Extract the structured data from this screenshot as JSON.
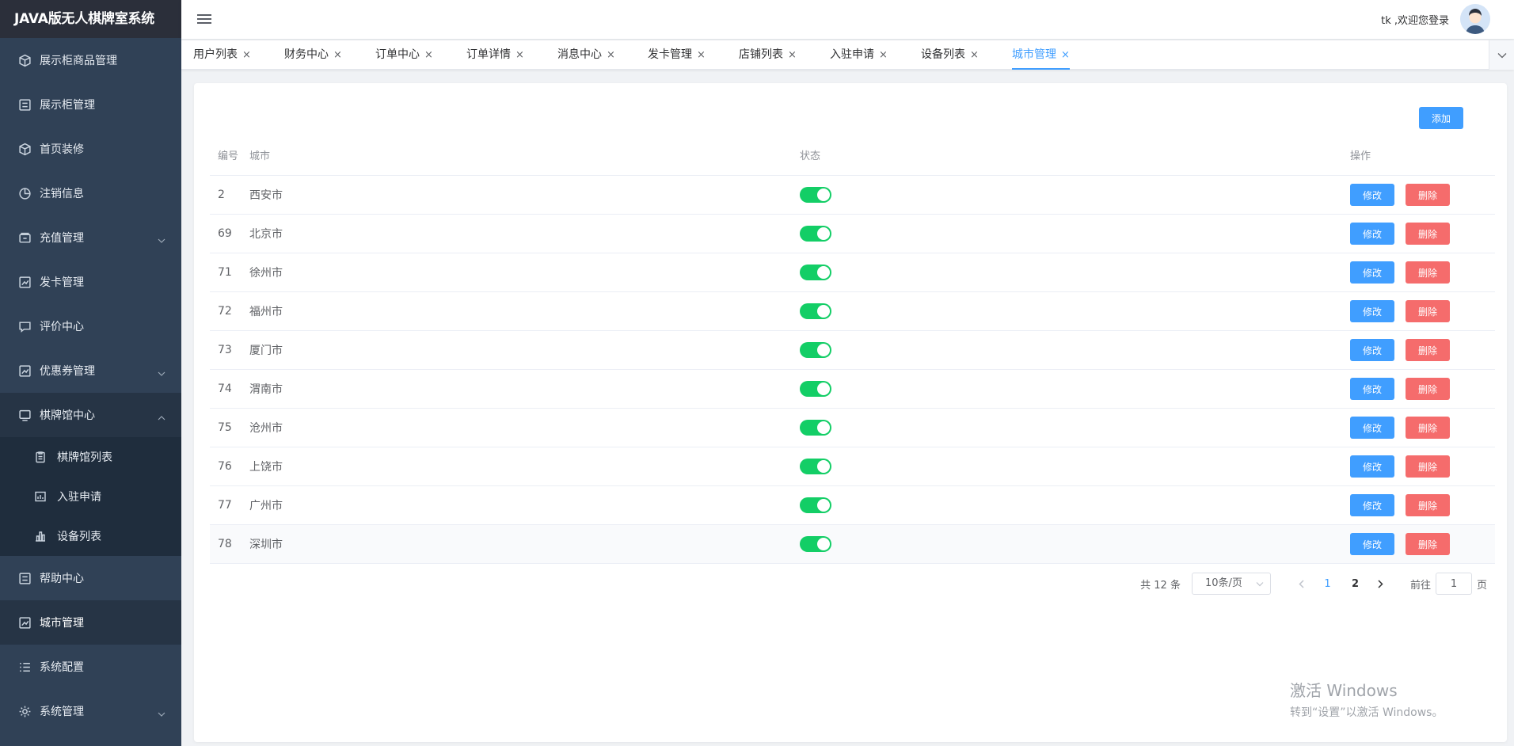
{
  "app": {
    "title": "JAVA版无人棋牌室系统"
  },
  "header": {
    "welcome": "tk ,欢迎您登录"
  },
  "sidebar": {
    "items": [
      {
        "label": "展示柜商品管理",
        "icon": "cube-icon"
      },
      {
        "label": "展示柜管理",
        "icon": "form-icon"
      },
      {
        "label": "首页装修",
        "icon": "cube-icon"
      },
      {
        "label": "注销信息",
        "icon": "pie-chart-icon"
      },
      {
        "label": "充值管理",
        "icon": "wallet-icon"
      },
      {
        "label": "发卡管理",
        "icon": "line-chart-icon"
      },
      {
        "label": "评价中心",
        "icon": "message-icon"
      },
      {
        "label": "优惠券管理",
        "icon": "line-chart-icon"
      },
      {
        "label": "棋牌馆中心",
        "icon": "monitor-icon"
      }
    ],
    "sub_items": [
      {
        "label": "棋牌馆列表",
        "icon": "clipboard-icon"
      },
      {
        "label": "入驻申请",
        "icon": "chart-board-icon"
      },
      {
        "label": "设备列表",
        "icon": "bar-chart-icon"
      }
    ],
    "bottom_items": [
      {
        "label": "帮助中心",
        "icon": "form-icon"
      },
      {
        "label": "城市管理",
        "icon": "line-chart-icon"
      },
      {
        "label": "系统配置",
        "icon": "list-icon"
      },
      {
        "label": "系统管理",
        "icon": "gear-icon"
      }
    ]
  },
  "tabs": [
    {
      "label": "用户列表"
    },
    {
      "label": "财务中心"
    },
    {
      "label": "订单中心"
    },
    {
      "label": "订单详情"
    },
    {
      "label": "消息中心"
    },
    {
      "label": "发卡管理"
    },
    {
      "label": "店铺列表"
    },
    {
      "label": "入驻申请"
    },
    {
      "label": "设备列表"
    },
    {
      "label": "城市管理",
      "active": true
    }
  ],
  "tab_close": "×",
  "toolbar": {
    "add_label": "添加"
  },
  "table": {
    "headers": {
      "id": "编号",
      "city": "城市",
      "status": "状态",
      "ops": "操作"
    },
    "edit_label": "修改",
    "delete_label": "删除",
    "rows": [
      {
        "id": "2",
        "city": "西安市",
        "enabled": true
      },
      {
        "id": "69",
        "city": "北京市",
        "enabled": true
      },
      {
        "id": "71",
        "city": "徐州市",
        "enabled": true
      },
      {
        "id": "72",
        "city": "福州市",
        "enabled": true
      },
      {
        "id": "73",
        "city": "厦门市",
        "enabled": true
      },
      {
        "id": "74",
        "city": "渭南市",
        "enabled": true
      },
      {
        "id": "75",
        "city": "沧州市",
        "enabled": true
      },
      {
        "id": "76",
        "city": "上饶市",
        "enabled": true
      },
      {
        "id": "77",
        "city": "广州市",
        "enabled": true
      },
      {
        "id": "78",
        "city": "深圳市",
        "enabled": true
      }
    ]
  },
  "pagination": {
    "total_text": "共 12 条",
    "page_size": "10条/页",
    "pages": [
      "1",
      "2"
    ],
    "current_page": "1",
    "goto_prefix": "前往",
    "goto_value": "1",
    "goto_suffix": "页"
  },
  "watermark": {
    "line1": "激活 Windows",
    "line2": "转到“设置”以激活 Windows。"
  },
  "colors": {
    "primary": "#409eff",
    "danger": "#f56c6c",
    "success": "#13ce66",
    "sidebar_bg": "#304156"
  }
}
